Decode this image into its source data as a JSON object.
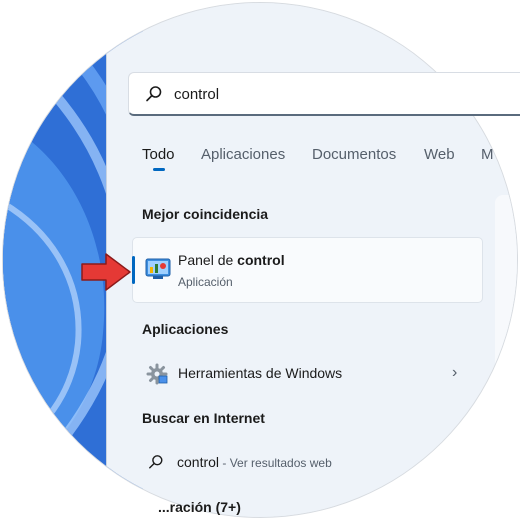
{
  "search": {
    "query": "control"
  },
  "tabs": [
    {
      "label": "Todo",
      "active": true
    },
    {
      "label": "Aplicaciones"
    },
    {
      "label": "Documentos"
    },
    {
      "label": "Web"
    },
    {
      "label": "M"
    }
  ],
  "best_match": {
    "section_title": "Mejor coincidencia",
    "name_prefix": "Panel de ",
    "name_bold": "control",
    "type": "Aplicación",
    "icon": "control-panel-icon"
  },
  "apps": {
    "section_title": "Aplicaciones",
    "items": [
      {
        "label": "Herramientas de Windows",
        "icon": "gear-icon"
      }
    ]
  },
  "web": {
    "section_title": "Buscar en Internet",
    "query": "control",
    "suffix": " - Ver resultados web"
  },
  "partial": {
    "label": "...ración (7+)"
  },
  "colors": {
    "accent": "#0067c0",
    "arrow": "#e53935"
  }
}
